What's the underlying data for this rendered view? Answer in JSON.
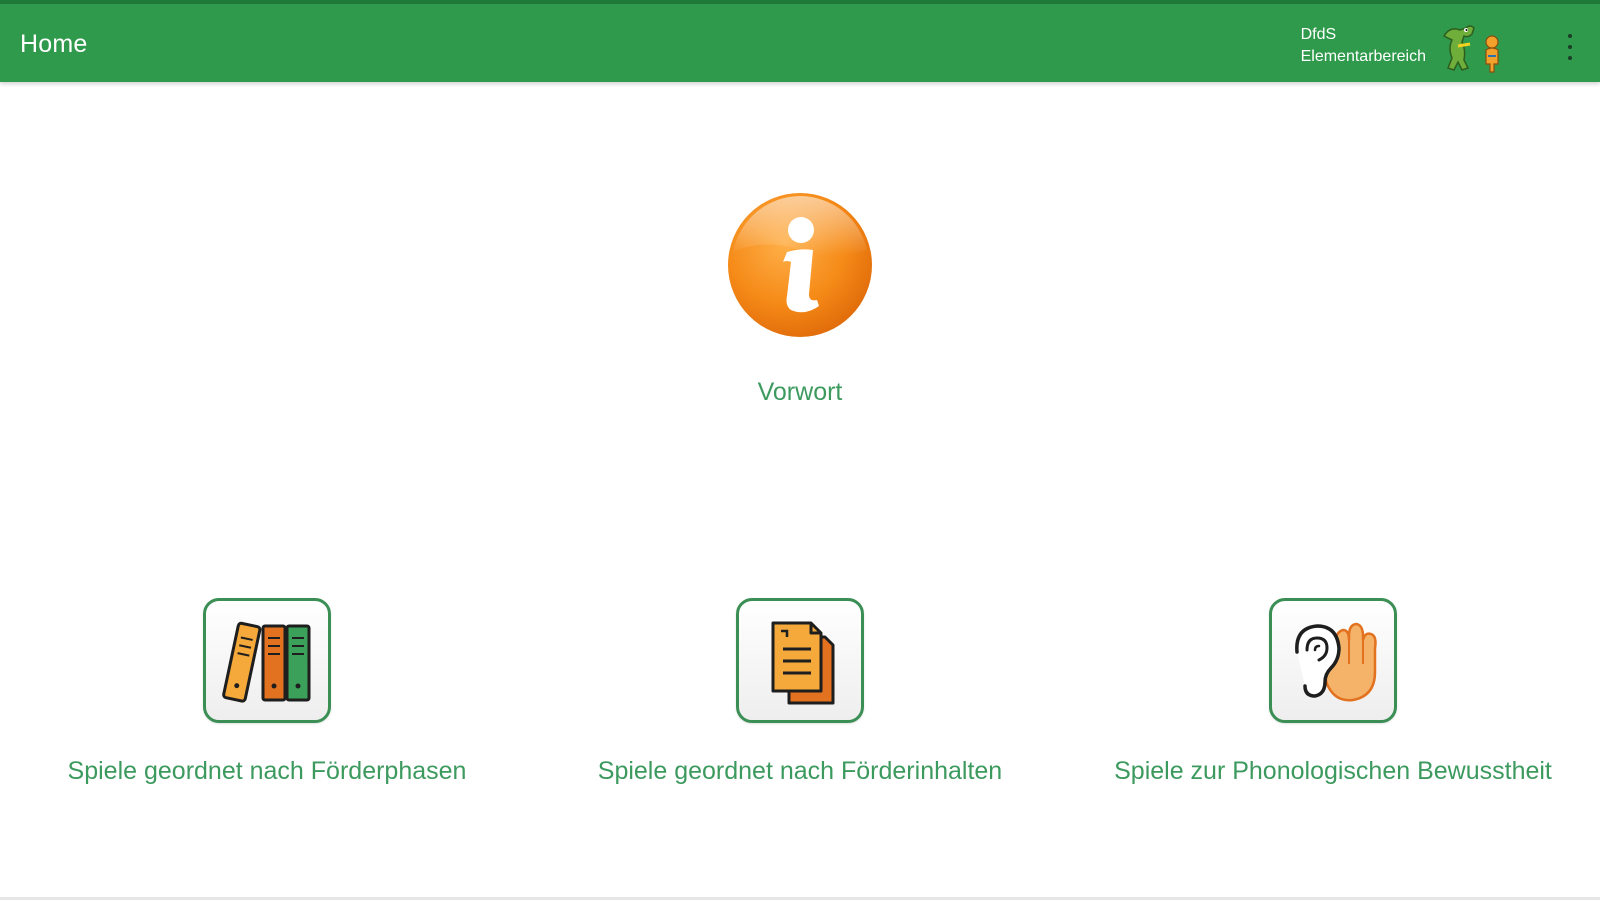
{
  "app_bar": {
    "title": "Home",
    "brand_line1": "DfdS",
    "brand_line2": "Elementarbereich",
    "brand_logo_icon": "crocodile-mascot-logo",
    "menu_icon": "more-vert-icon",
    "background_color": "#2f9a4b"
  },
  "main": {
    "vorwort": {
      "icon": "info-icon",
      "label": "Vorwort",
      "icon_color": "#f08a1a"
    },
    "tiles": [
      {
        "icon": "binders-icon",
        "label": "Spiele geordnet nach Förderphasen"
      },
      {
        "icon": "documents-icon",
        "label": "Spiele geordnet nach Förderinhalten"
      },
      {
        "icon": "ear-hand-icon",
        "label": "Spiele zur Phonologischen Bewusstheit"
      }
    ],
    "label_color": "#3d9a5f"
  }
}
